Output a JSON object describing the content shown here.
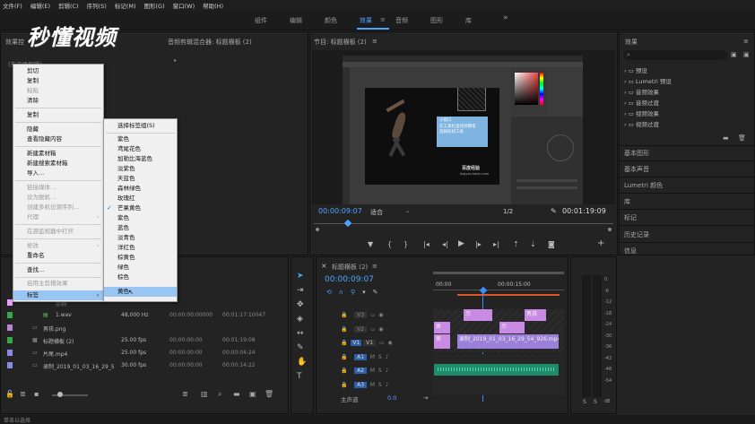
{
  "menubar": {
    "items": [
      "文件(F)",
      "编辑(E)",
      "剪辑(C)",
      "序列(S)",
      "标记(M)",
      "图形(G)",
      "窗口(W)",
      "帮助(H)"
    ]
  },
  "workspaces": {
    "tabs": [
      "组件",
      "编辑",
      "颜色",
      "效果",
      "音频",
      "图形",
      "库"
    ],
    "active": "效果",
    "more": "»"
  },
  "watermark": "秒懂视频",
  "source_panel": {
    "tab_effects_controls": "效果控",
    "tab_audio_mixer": "音频剪辑混合器: 标题横板 (2)",
    "no_clip": "(未选择剪辑)"
  },
  "program_monitor": {
    "title": "节目: 标题横板 (2)",
    "timecode": "00:00:09:07",
    "fit": "适合",
    "resolution": "1/2",
    "duration": "00:01:19:09",
    "screen_text": [
      "小窗口",
      "在工具栏里找到钢笔",
      "选择形状工具"
    ],
    "screen_logo": "百度经验",
    "screen_url": "jingyan.baidu.com"
  },
  "effects_panel": {
    "title": "效果",
    "tree": [
      "预设",
      "Lumetri 预设",
      "音频效果",
      "音频过渡",
      "视频效果",
      "视频过渡"
    ],
    "sections": [
      "基本图形",
      "基本声音",
      "Lumetri 颜色",
      "库",
      "标记",
      "历史记录",
      "信息"
    ]
  },
  "context_menu": {
    "items": [
      {
        "label": "剪切",
        "disabled": false
      },
      {
        "label": "复制",
        "disabled": false
      },
      {
        "label": "粘贴",
        "disabled": true
      },
      {
        "label": "清除",
        "disabled": false
      },
      {
        "label": "复制",
        "disabled": false
      },
      {
        "label": "隐藏",
        "disabled": false
      },
      {
        "label": "查看隐藏内容",
        "disabled": false
      },
      {
        "label": "新建素材箱",
        "disabled": false
      },
      {
        "label": "新建搜索素材箱",
        "disabled": false
      },
      {
        "label": "导入...",
        "disabled": false
      },
      {
        "label": "链接媒体...",
        "disabled": true
      },
      {
        "label": "设为脱机...",
        "disabled": true
      },
      {
        "label": "创建多机位源序列...",
        "disabled": true
      },
      {
        "label": "代理",
        "disabled": true
      },
      {
        "label": "在源监视器中打开",
        "disabled": true
      },
      {
        "label": "修改",
        "disabled": true
      },
      {
        "label": "重命名",
        "disabled": false
      },
      {
        "label": "查找...",
        "disabled": false
      },
      {
        "label": "启用主剪辑效果",
        "disabled": true
      },
      {
        "label": "标签",
        "disabled": false
      }
    ]
  },
  "label_submenu": {
    "items": [
      "选择标签组(S)",
      "紫色",
      "鸢尾花色",
      "加勒比海蓝色",
      "淡紫色",
      "天蓝色",
      "森林绿色",
      "玫瑰红",
      "芒果黄色",
      "紫色",
      "蓝色",
      "淡青色",
      "洋红色",
      "棕黄色",
      "绿色",
      "棕色",
      "黄色"
    ],
    "checked": "芒果黄色",
    "hovered": "黄色"
  },
  "project_panel": {
    "rows": [
      {
        "name": "示例",
        "rate": "",
        "start": "",
        "end": "",
        "color": "#e8a0ff"
      },
      {
        "name": "1.wav",
        "rate": "48,000 Hz",
        "start": "00:00:00:00000",
        "end": "00:01:17:10047",
        "color": "#3aa64a"
      },
      {
        "name": "男孩.png",
        "rate": "",
        "start": "",
        "end": "",
        "color": "#b983d6"
      },
      {
        "name": "标题横板 (2)",
        "rate": "25.00 fps",
        "start": "00:00:00:00",
        "end": "00:01:19:08",
        "color": "#3aa64a"
      },
      {
        "name": "片尾.mp4",
        "rate": "25.00 fps",
        "start": "00:00:00:00",
        "end": "00:00:04:24",
        "color": "#8a8ae0"
      },
      {
        "name": "录制_2019_01_03_16_29_5",
        "rate": "30.00 fps",
        "start": "00:00:00:00",
        "end": "00:00:14:22",
        "color": "#8a8ae0"
      }
    ]
  },
  "timeline": {
    "title": "标题横板 (2)",
    "timecode": "00:00:09:07",
    "ruler": [
      "00:00",
      "00:00:15:00"
    ],
    "tracks": [
      "V3",
      "V2",
      "V1",
      "A1",
      "A2",
      "A3"
    ],
    "master": "主声道",
    "master_value": "0.0",
    "clips": [
      {
        "label": "示",
        "track": "V3"
      },
      {
        "label": "男孩",
        "track": "V3"
      },
      {
        "label": "男",
        "track": "V2"
      },
      {
        "label": "示",
        "track": "V2"
      },
      {
        "label": "男",
        "track": "V1"
      },
      {
        "label": "录制_2019_01_03_16_29_54_926.mp4",
        "track": "V1"
      }
    ]
  },
  "meter": {
    "labels": [
      "0",
      "-6",
      "-12",
      "-18",
      "-24",
      "-30",
      "-36",
      "-42",
      "-48",
      "-54"
    ],
    "bottom": [
      "S",
      "S"
    ],
    "unit": "dB"
  },
  "status_bar": "单击以选择",
  "colors": {
    "accent": "#4fa3ff",
    "timeline_purple": "#c98ae3",
    "audio_green": "#1e8b6b",
    "playhead": "#3d8bff"
  }
}
